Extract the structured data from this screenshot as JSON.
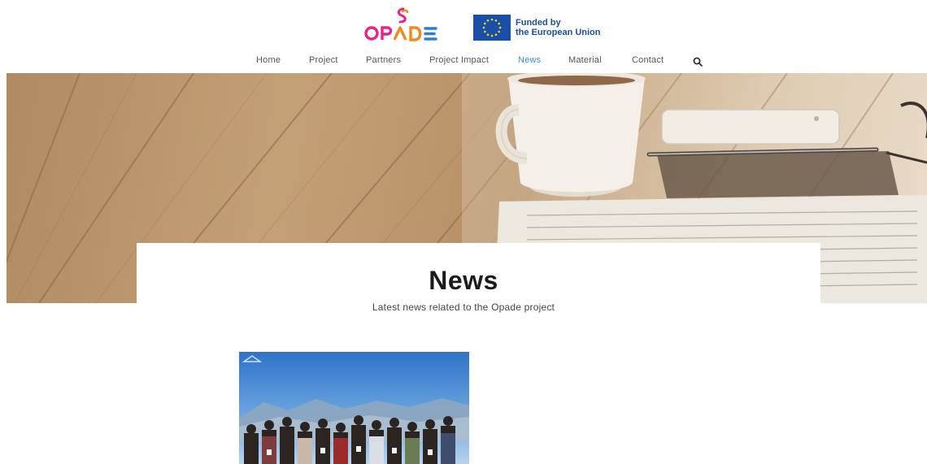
{
  "header": {
    "logo_text": "OPADE",
    "eu_line1": "Funded by",
    "eu_line2": "the European Union"
  },
  "nav": {
    "items": [
      {
        "label": "Home"
      },
      {
        "label": "Project"
      },
      {
        "label": "Partners"
      },
      {
        "label": "Project Impact"
      },
      {
        "label": "News"
      },
      {
        "label": "Material"
      },
      {
        "label": "Contact"
      }
    ],
    "active": "News",
    "search_icon": "search-icon"
  },
  "page": {
    "title": "News",
    "subtitle": "Latest news related to the Opade project"
  },
  "colors": {
    "nav_active": "#3b8ed8",
    "eu_blue": "#1a4fa8",
    "logo_pink": "#e6248a",
    "logo_orange": "#f28a1b",
    "logo_blue": "#2b7fd8"
  }
}
